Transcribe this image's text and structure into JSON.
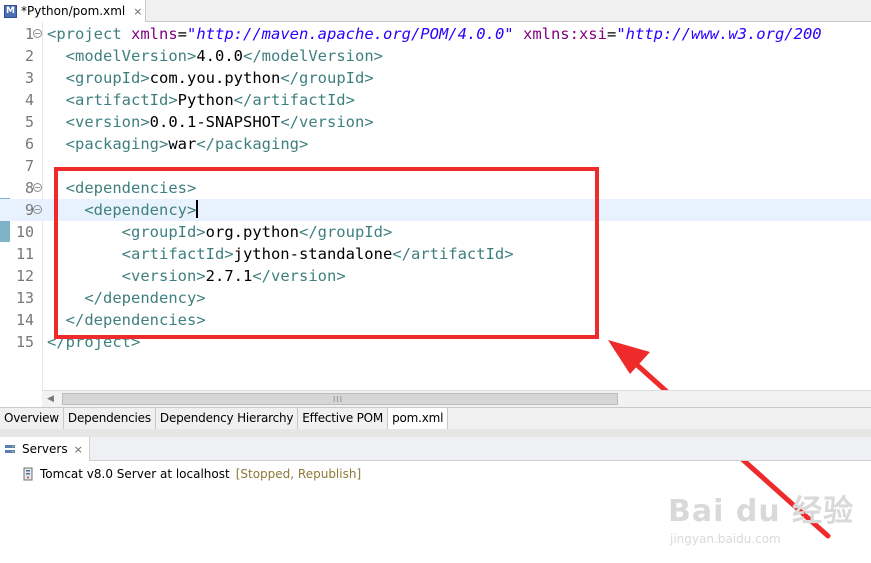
{
  "editor_tab": {
    "title": "*Python/pom.xml",
    "icon_letter": "M",
    "close_glyph": "×"
  },
  "code_lines": [
    {
      "num": "1",
      "fold": "−",
      "parts": [
        [
          "t",
          "<project "
        ],
        [
          "a",
          "xmlns"
        ],
        [
          "x",
          "="
        ],
        [
          "s",
          "\"http://maven.apache.org/POM/4.0.0\""
        ],
        [
          "x",
          " "
        ],
        [
          "a",
          "xmlns:xsi"
        ],
        [
          "x",
          "="
        ],
        [
          "s",
          "\"http://www.w3.org/200"
        ]
      ]
    },
    {
      "num": "2",
      "parts": [
        [
          "x",
          "  "
        ],
        [
          "t",
          "<modelVersion>"
        ],
        [
          "x",
          "4.0.0"
        ],
        [
          "t",
          "</modelVersion>"
        ]
      ]
    },
    {
      "num": "3",
      "parts": [
        [
          "x",
          "  "
        ],
        [
          "t",
          "<groupId>"
        ],
        [
          "x",
          "com.you.python"
        ],
        [
          "t",
          "</groupId>"
        ]
      ]
    },
    {
      "num": "4",
      "parts": [
        [
          "x",
          "  "
        ],
        [
          "t",
          "<artifactId>"
        ],
        [
          "x",
          "Python"
        ],
        [
          "t",
          "</artifactId>"
        ]
      ]
    },
    {
      "num": "5",
      "parts": [
        [
          "x",
          "  "
        ],
        [
          "t",
          "<version>"
        ],
        [
          "x",
          "0.0.1-SNAPSHOT"
        ],
        [
          "t",
          "</version>"
        ]
      ]
    },
    {
      "num": "6",
      "parts": [
        [
          "x",
          "  "
        ],
        [
          "t",
          "<packaging>"
        ],
        [
          "x",
          "war"
        ],
        [
          "t",
          "</packaging>"
        ]
      ]
    },
    {
      "num": "7",
      "parts": []
    },
    {
      "num": "8",
      "fold": "−",
      "parts": [
        [
          "x",
          "  "
        ],
        [
          "t",
          "<dependencies>"
        ]
      ]
    },
    {
      "num": "9",
      "fold": "−",
      "current": true,
      "parts": [
        [
          "x",
          "    "
        ],
        [
          "t",
          "<dependency>"
        ]
      ]
    },
    {
      "num": "10",
      "parts": [
        [
          "x",
          "        "
        ],
        [
          "t",
          "<groupId>"
        ],
        [
          "x",
          "org.python"
        ],
        [
          "t",
          "</groupId>"
        ]
      ]
    },
    {
      "num": "11",
      "parts": [
        [
          "x",
          "        "
        ],
        [
          "t",
          "<artifactId>"
        ],
        [
          "x",
          "jython-standalone"
        ],
        [
          "t",
          "</artifactId>"
        ]
      ]
    },
    {
      "num": "12",
      "parts": [
        [
          "x",
          "        "
        ],
        [
          "t",
          "<version>"
        ],
        [
          "x",
          "2.7.1"
        ],
        [
          "t",
          "</version>"
        ]
      ]
    },
    {
      "num": "13",
      "parts": [
        [
          "x",
          "    "
        ],
        [
          "t",
          "</dependency>"
        ]
      ]
    },
    {
      "num": "14",
      "parts": [
        [
          "x",
          "  "
        ],
        [
          "t",
          "</dependencies>"
        ]
      ]
    },
    {
      "num": "15",
      "parts": [
        [
          "t",
          "</project>"
        ]
      ]
    }
  ],
  "scrollbar": {
    "grip": "III"
  },
  "pom_tabs": [
    {
      "label": "Overview",
      "active": false
    },
    {
      "label": "Dependencies",
      "active": false
    },
    {
      "label": "Dependency Hierarchy",
      "active": false
    },
    {
      "label": "Effective POM",
      "active": false
    },
    {
      "label": "pom.xml",
      "active": true
    }
  ],
  "servers_view": {
    "tab_label": "Servers",
    "close_glyph": "×",
    "server_name": "Tomcat v8.0 Server at localhost",
    "server_status": "[Stopped, Republish]"
  },
  "watermark": {
    "main": "Bai du 经验",
    "sub": "jingyan.baidu.com"
  },
  "colors": {
    "tag": "#3f7f7f",
    "attr": "#7f007f",
    "string": "#2a00ff",
    "highlight_box": "#ef2a2a",
    "current_line": "#e8f2fe"
  }
}
